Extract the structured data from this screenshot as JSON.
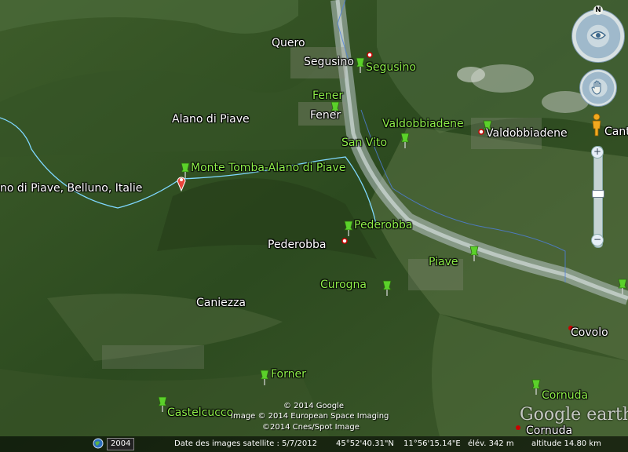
{
  "places": {
    "quero": "Quero",
    "segusino_town": "Segusino",
    "segusino_pin": "Segusino",
    "fener_pin": "Fener",
    "fener_town": "Fener",
    "alano": "Alano di Piave",
    "valdobbiadene_pin": "Valdobbiadene",
    "valdobbiadene_town": "Valdobbiadene",
    "cant": "Cant",
    "san_vito": "San Vito",
    "monte_tomba": "Monte Tomba-Alano di Piave",
    "search_result": "no di Piave, Belluno, Italie",
    "pederobba_pin": "Pederobba",
    "pederobba_town": "Pederobba",
    "piave": "Piave",
    "curogna": "Curogna",
    "caniezza": "Caniezza",
    "covolo": "Covolo",
    "forner": "Forner",
    "cornuda_pin": "Cornuda",
    "cornuda_town": "Cornuda",
    "castelcucco": "Castelcucco"
  },
  "copyright": {
    "line1": "© 2014 Google",
    "line2": "Image © 2014 European Space Imaging",
    "line3": "©2014 Cnes/Spot Image"
  },
  "watermark": "Google earth",
  "status": {
    "year": "2004",
    "imagery_date": "Date des images satellite : 5/7/2012",
    "lat": "45°52'40.31\"N",
    "lon": "11°56'15.14\"E",
    "elev": "élév.  342 m",
    "altitude": "altitude  14.80 km"
  },
  "nav": {
    "north": "N"
  },
  "colors": {
    "pin": "#5bd12a",
    "label_green": "#8ff04a",
    "track": "#7fd8ff",
    "river": "#b9c7c9"
  },
  "icons": {
    "pushpin": "green-pushpin-icon",
    "search_marker": "red-placemark-icon",
    "pegman": "street-view-pegman-icon"
  }
}
